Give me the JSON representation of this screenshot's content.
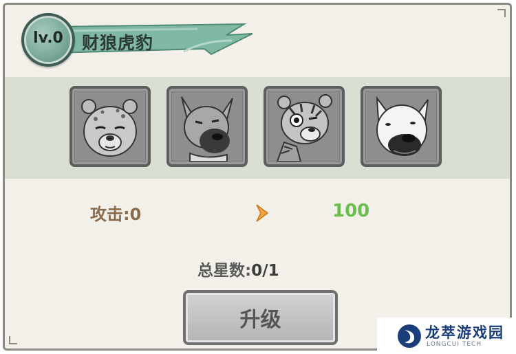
{
  "title": {
    "level": "lv.0",
    "name": "财狼虎豹"
  },
  "portraits": [
    {
      "icon": "leopard-portrait-icon"
    },
    {
      "icon": "wolf-portrait-icon"
    },
    {
      "icon": "tiger-portrait-icon"
    },
    {
      "icon": "dog-portrait-icon"
    }
  ],
  "stats": {
    "attack_label": "攻击:0",
    "arrow_icon": "chevron-right-icon",
    "attack_next": "100"
  },
  "stars": {
    "label": "总星数:",
    "value": "0/1"
  },
  "upgrade_button": {
    "label": "升级",
    "state": "disabled"
  },
  "watermark": {
    "name": "龙萃游戏园",
    "sub": "LONGCUI TECH"
  },
  "colors": {
    "panel_bg": "#f3f0ea",
    "strip_bg": "#d9dfd2",
    "banner": "#7fb9a3",
    "attack_label": "#8a6a4c",
    "attack_next": "#6cbe4b",
    "arrow": "#f1a43a"
  }
}
